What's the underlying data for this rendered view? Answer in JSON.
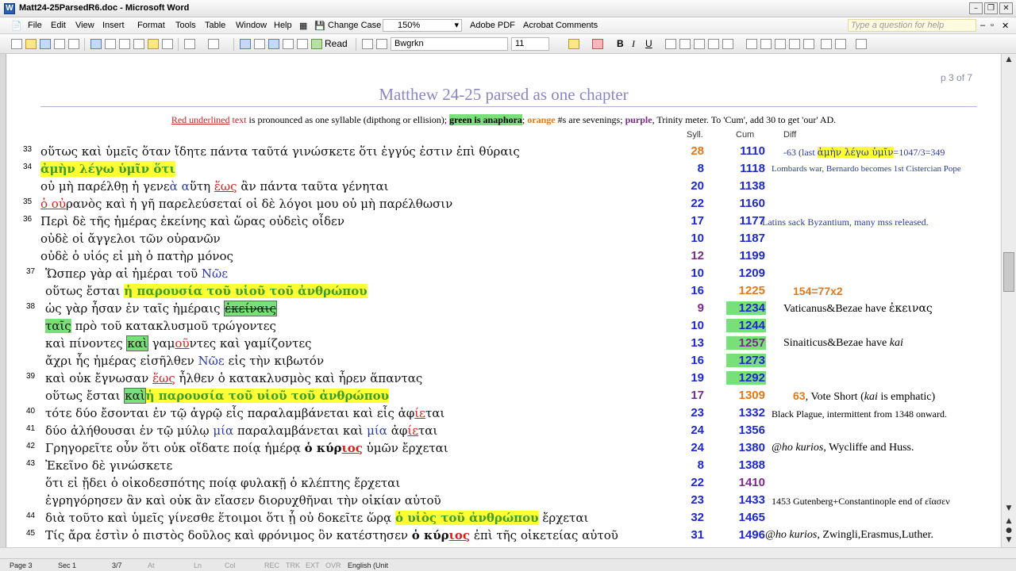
{
  "window": {
    "title": "Matt24-25ParsedR6.doc - Microsoft Word"
  },
  "menu": {
    "items": [
      "File",
      "Edit",
      "View",
      "Insert",
      "Format",
      "Tools",
      "Table",
      "Window",
      "Help"
    ],
    "change_case": "Change Case",
    "zoom": "150%",
    "adobe_pdf": "Adobe PDF",
    "acrobat_comments": "Acrobat Comments",
    "help_box": "Type a question for help"
  },
  "toolbar": {
    "read_label": "Read",
    "font_name": "Bwgrkn",
    "font_size": "11"
  },
  "doc": {
    "page_indicator": "p 3 of 7",
    "title": "Matthew 24-25 parsed as one chapter",
    "legend": {
      "p1": "Red underlined",
      "p2": " text",
      "p3": " is pronounced as one syllable (dipthong or ellision); ",
      "p4": "green is anaphora",
      "p5": "; ",
      "p6": "orange",
      "p7": " #s are sevenings; ",
      "p8": "purple",
      "p9": ", Trinity meter.  To 'Cum', add 30 to get 'our' AD."
    },
    "col_syll": "Syll.",
    "col_cum": "Cum",
    "col_diff": "Diff",
    "rows": [
      {
        "n": "33",
        "s": "28",
        "c": "1110",
        "t": "οὕτως καὶ ὑμεῖς ὅταν ἴδητε πάντα ταῦτά γινώσκετε ὅτι ἐγγύς ἐστιν ἐπὶ θύραις"
      },
      {
        "n": "34",
        "s": "8",
        "c": "1118",
        "t": "ἀμὴν λέγω ὑμῖν ὅτι"
      },
      {
        "n": "",
        "s": "20",
        "c": "1138",
        "t1": "οὐ μὴ παρέλθῃ ἡ γενε",
        "t2": "ὰ α",
        "t3": "ὕτη ",
        "t4": "ἕως",
        "t5": " ἂν πάντα ταῦτα γένηται"
      },
      {
        "n": "35",
        "s": "22",
        "c": "1160",
        "t1": "ὁ οὐ",
        "t2": "ρανὸς καὶ ἡ γῆ παρελεύσεταί οἱ δὲ λόγοι μου οὐ μὴ παρέλθωσιν"
      },
      {
        "n": "36",
        "s": "17",
        "c": "1177",
        "t": "Περὶ δὲ τῆς ἡμέρας ἐκείνης καὶ ὥρας οὐδεὶς οἶδεν"
      },
      {
        "n": "",
        "s": "10",
        "c": "1187",
        "t": "οὐδὲ οἱ ἄγγελοι τῶν οὐρανῶν"
      },
      {
        "n": "",
        "s": "12",
        "c": "1199",
        "t": "οὐδὲ ὁ υἱός εἰ μὴ ὁ πατὴρ μόνος"
      },
      {
        "n": "37",
        "s": "10",
        "c": "1209",
        "t1": "Ὥσπερ γὰρ αἱ ἡμέραι τοῦ ",
        "t2": "Νῶε"
      },
      {
        "n": "",
        "s": "16",
        "c": "1225",
        "t1": "οὕτως ἔσται ",
        "t2": "ἡ παρουσία τοῦ υἱοῦ τοῦ ἀνθρώπου"
      },
      {
        "n": "38",
        "s": "9",
        "c": "1234",
        "t1": "ὡς γὰρ ἦσαν ἐν ταῖς ἡμέραις ",
        "t2": "ἐκείναις"
      },
      {
        "n": "",
        "s": "10",
        "c": "1244",
        "t1": "ταῖς",
        "t2": " πρὸ τοῦ κατακλυσμοῦ τρώγοντες"
      },
      {
        "n": "",
        "s": "13",
        "c": "1257",
        "t1": "καὶ πίνοντες ",
        "t2": "καὶ",
        "t3": " γαμ",
        "t4": "οῦ",
        "t5": "ντες καὶ γαμίζοντες"
      },
      {
        "n": "",
        "s": "16",
        "c": "1273",
        "t1": "ἄχρι ἧς ἡμέρας εἰσῆλθεν ",
        "t2": "Νῶε",
        "t3": " εἰς τὴν κιβωτόν"
      },
      {
        "n": "39",
        "s": "19",
        "c": "1292",
        "t1": "καὶ οὐκ ἔγνωσαν ",
        "t2": "ἕως",
        "t3": " ἦλθεν ὁ κατακλυσμὸς καὶ ἦρεν ἅπαντας"
      },
      {
        "n": "",
        "s": "17",
        "c": "1309",
        "t1": "οὕτως ἔσται ",
        "t2": "καὶ",
        "t3": "ἡ παρουσία τοῦ υἱοῦ τοῦ ἀνθρώπου"
      },
      {
        "n": "40",
        "s": "23",
        "c": "1332",
        "t1": "τότε δύο ἔσονται ἐν τῷ ἀγρῷ εἷς παραλαμβάνεται καὶ εἷς ἀφ",
        "t2": "ίε",
        "t3": "ται"
      },
      {
        "n": "41",
        "s": "24",
        "c": "1356",
        "t1": "δύο ἀλήθουσαι ἐν τῷ μύλῳ ",
        "t2": "μία",
        "t3": " παραλαμβάνεται καὶ ",
        "t4": "μία",
        "t5": " ἀφ",
        "t6": "ίε",
        "t7": "ται"
      },
      {
        "n": "42",
        "s": "24",
        "c": "1380",
        "t1": "Γρηγορεῖτε οὖν ὅτι οὐκ οἴδατε ποίᾳ ἡμέρᾳ ",
        "t2": "ὁ κύρ",
        "t3": "ιος",
        "t4": " ὑμῶν ἔρχεται"
      },
      {
        "n": "43",
        "s": "8",
        "c": "1388",
        "t": "Ἐκεῖνο δὲ γινώσκετε"
      },
      {
        "n": "",
        "s": "22",
        "c": "1410",
        "t": "ὅτι εἰ ᾔδει ὁ οἰκοδεσπότης ποίᾳ φυλακῇ ὁ κλέπτης ἔρχεται"
      },
      {
        "n": "",
        "s": "23",
        "c": "1433",
        "t": "ἐγρηγόρησεν ἂν καὶ οὐκ ἂν εἴασεν διορυχθῆναι τὴν οἰκίαν αὐτοῦ"
      },
      {
        "n": "44",
        "s": "32",
        "c": "1465",
        "t1": "διὰ τοῦτο καὶ ὑμεῖς γίνεσθε ἕτοιμοι ὅτι ᾗ οὐ δοκεῖτε ὥρᾳ ",
        "t2": "ὁ υἱὸς τοῦ ἀνθρώπου",
        "t3": " ἔρχεται"
      },
      {
        "n": "45",
        "s": "31",
        "c": "1496",
        "t1": "Τίς ἄρα ἐστὶν ὁ πιστὸς δοῦλος καὶ φρόνιμος ὃν κατέστησεν ",
        "t2": "ὁ κύρ",
        "t3": "ιος",
        "t4": " ἐπὶ τῆς οἰκετείας αὐτοῦ"
      }
    ],
    "diffs": {
      "d33a": "-63 (last ",
      "d33b": "ἀμὴν λέγω ὑμῖν",
      "d33c": "=1047/3=349",
      "d34": "Lombards war, Bernardo becomes 1st Cistercian Pope",
      "d36": "Latins sack Byzantium, many mss released.",
      "d37": "154=77x2",
      "d38a": "Vaticanus&Bezae have ",
      "d38b": "ἐκεινας",
      "d39": "Sinaiticus&Bezae have ",
      "d39i": "kai",
      "d41a": "63",
      ", ": "",
      "d41b": ", Vote Short (",
      "d41c": "kai",
      "d41d": " is emphatic)",
      "d42": "Black Plague, intermittent from 1348 onward.",
      "d44a": "@ho kurios",
      "d44b": ", Wycliffe and Huss.",
      "d47": "1453 Gutenberg+Constantinople end of εἴασεν",
      "d49a": "@ho kurios",
      "d49b": ", Zwingli,Erasmus,Luther."
    }
  },
  "status": {
    "page": "Page 3",
    "sec": "Sec 1",
    "pos": "3/7",
    "at": "At",
    "ln": "Ln",
    "col": "Col",
    "rec": "REC",
    "trk": "TRK",
    "ext": "EXT",
    "ovr": "OVR",
    "lang": "English (Unit"
  },
  "colors": {
    "blue": "#1d29c9",
    "orange": "#e07a1a",
    "purple": "#7a2a8a",
    "anaphora_green": "#79e079",
    "highlight_yellow": "#ffff33",
    "red": "#d52020"
  }
}
